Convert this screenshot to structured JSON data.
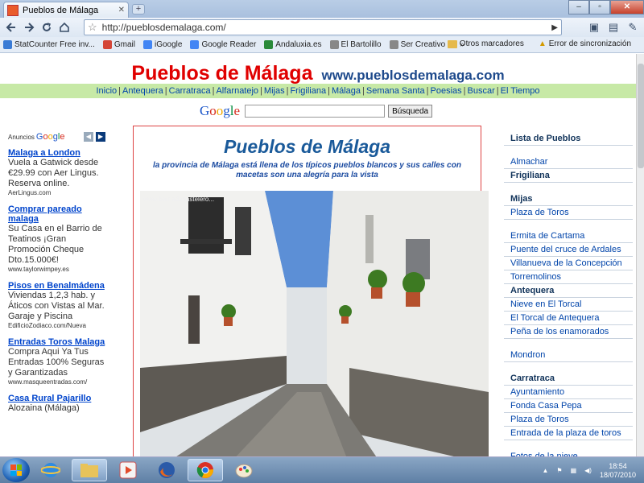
{
  "browser": {
    "tab_title": "Pueblos de Málaga",
    "url": "http://pueblosdemalaga.com/",
    "bookmarks": [
      {
        "label": "StatCounter Free inv...",
        "color": "#3a7bd5"
      },
      {
        "label": "Gmail",
        "color": "#d44638"
      },
      {
        "label": "iGoogle",
        "color": "#4285f4"
      },
      {
        "label": "Google Reader",
        "color": "#4285f4"
      },
      {
        "label": "Andaluxia.es",
        "color": "#2a8a3a"
      },
      {
        "label": "El Bartolillo",
        "color": "#888888"
      },
      {
        "label": "Ser Creativo",
        "color": "#888888"
      }
    ],
    "bookmarks_more": "»",
    "other_bookmarks": "Otros marcadores",
    "sync_error": "Error de sincronización"
  },
  "site": {
    "name": "Pueblos de Málaga",
    "domain": "www.pueblosdemalaga.com",
    "nav": [
      "Inicio",
      "Antequera",
      "Carratraca",
      "Alfarnatejo",
      "Mijas",
      "Frigiliana",
      "Málaga",
      "Semana Santa",
      "Poesias",
      "Buscar",
      "El Tiempo"
    ],
    "search_button": "Búsqueda"
  },
  "ads": {
    "header": "Anuncios",
    "items": [
      {
        "title": "Malaga a London",
        "text": "Vuela a Gatwick desde €29.99 con Aer Lingus. Reserva online.",
        "url": "AerLingus.com"
      },
      {
        "title": "Comprar pareado malaga",
        "text": "Su Casa en el Barrio de Teatinos ¡Gran Promoción Cheque Dto.15.000€!",
        "url": "www.taylorwimpey.es"
      },
      {
        "title": "Pisos en Benalmádena",
        "text": "Viviendas 1,2,3 hab. y Áticos con Vistas al Mar. Garaje y Piscina",
        "url": "EdificioZodiaco.com/Nueva"
      },
      {
        "title": "Entradas Toros Malaga",
        "text": "Compra Aqui Ya Tus Entradas 100% Seguras y Garantizadas",
        "url": "www.masqueentradas.com/"
      },
      {
        "title": "Casa Rural Pajarillo",
        "text": "Alozaina (Málaga)",
        "url": ""
      }
    ]
  },
  "feature": {
    "title": "Pueblos de Málaga",
    "subtitle": "la provincia de Málaga está llena de los típicos pueblos blancos y sus calles con macetas son una alegría para la vista",
    "watermark": "www.barriadapastelero..."
  },
  "rightcol": {
    "items": [
      {
        "kind": "head",
        "label": "Lista de Pueblos"
      },
      {
        "kind": "gap"
      },
      {
        "kind": "link",
        "label": "Almachar"
      },
      {
        "kind": "head",
        "label": "Frigiliana"
      },
      {
        "kind": "gap"
      },
      {
        "kind": "head",
        "label": "Mijas"
      },
      {
        "kind": "link",
        "label": "Plaza de Toros"
      },
      {
        "kind": "gap"
      },
      {
        "kind": "link",
        "label": "Ermita de Cartama"
      },
      {
        "kind": "link",
        "label": "Puente del cruce de Ardales"
      },
      {
        "kind": "link",
        "label": "Villanueva de la Concepción"
      },
      {
        "kind": "link",
        "label": "Torremolinos"
      },
      {
        "kind": "head",
        "label": "Antequera"
      },
      {
        "kind": "link",
        "label": "Nieve en El Torcal"
      },
      {
        "kind": "link",
        "label": "El Torcal de Antequera"
      },
      {
        "kind": "link",
        "label": "Peña de los enamorados"
      },
      {
        "kind": "gap"
      },
      {
        "kind": "link",
        "label": "Mondron"
      },
      {
        "kind": "gap"
      },
      {
        "kind": "head",
        "label": "Carratraca"
      },
      {
        "kind": "link",
        "label": "Ayuntamiento"
      },
      {
        "kind": "link",
        "label": "Fonda Casa Pepa"
      },
      {
        "kind": "link",
        "label": "Plaza de Toros"
      },
      {
        "kind": "link",
        "label": "Entrada de la plaza de toros"
      },
      {
        "kind": "gap"
      },
      {
        "kind": "link",
        "label": "Fotos de la nieve"
      }
    ]
  },
  "taskbar": {
    "time": "18:54",
    "date": "18/07/2010"
  }
}
